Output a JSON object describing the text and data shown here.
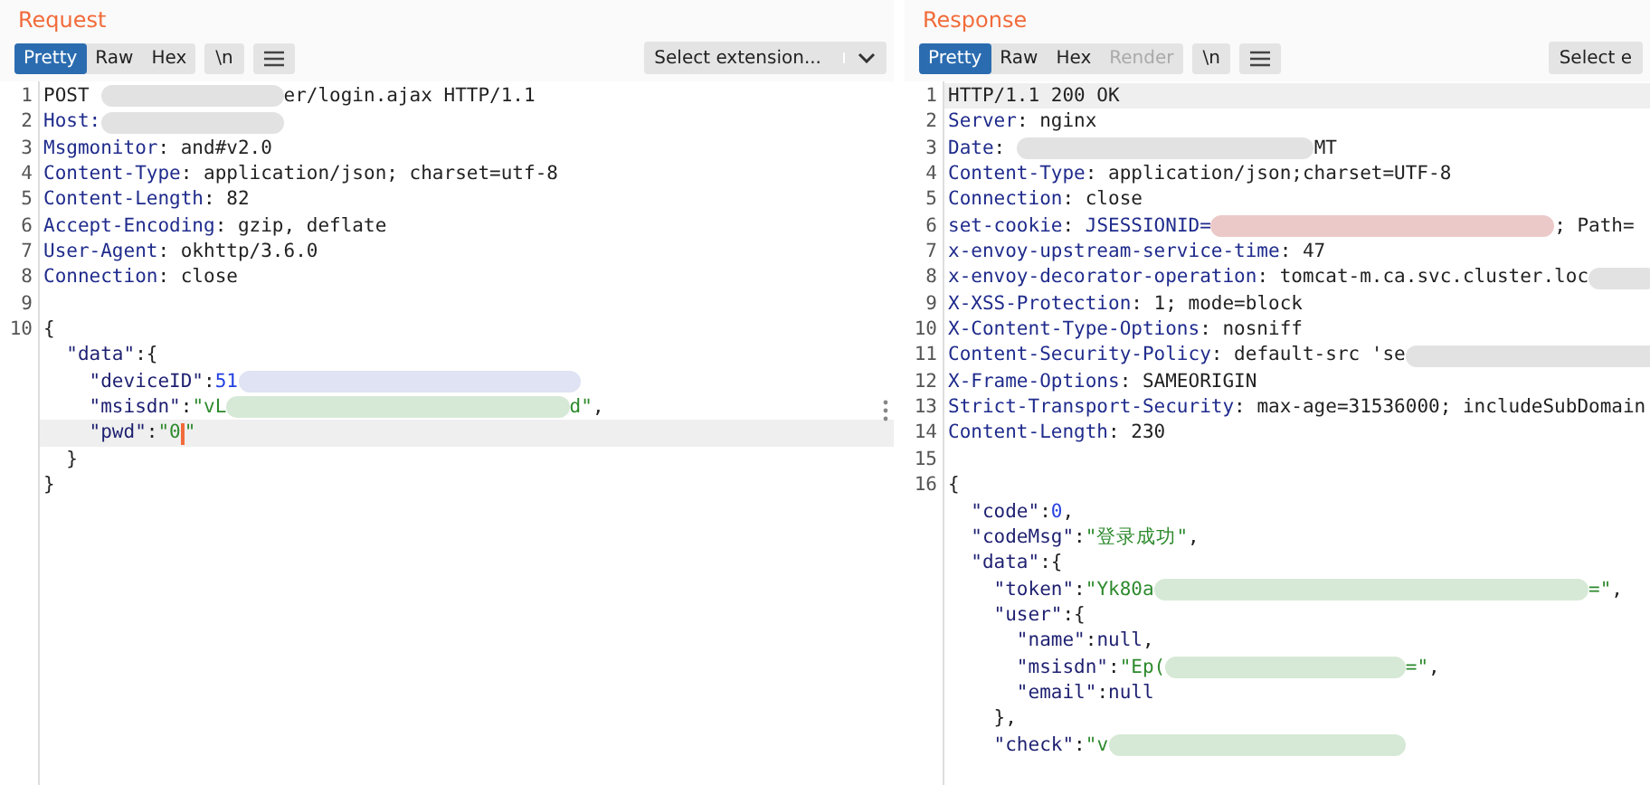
{
  "panels": [
    {
      "title": "Request",
      "view_tabs": [
        {
          "label": "Pretty",
          "selected": true,
          "disabled": false
        },
        {
          "label": "Raw",
          "selected": false,
          "disabled": false
        },
        {
          "label": "Hex",
          "selected": false,
          "disabled": false
        }
      ],
      "newline_button": "\\n",
      "extension_select": "Select extension...",
      "drag_handle": true,
      "lines": [
        {
          "num": "1",
          "current": false,
          "segs": [
            {
              "kind": "plain",
              "t": "POST "
            },
            {
              "kind": "blurmedium",
              "color": "#e2e2e2"
            },
            {
              "kind": "plain",
              "t": "er/login.ajax HTTP/1.1"
            }
          ]
        },
        {
          "num": "2",
          "current": false,
          "segs": [
            {
              "kind": "header",
              "t": "Host:"
            },
            {
              "kind": "blurmedium",
              "color": "#e2e2e2"
            }
          ]
        },
        {
          "num": "3",
          "current": false,
          "segs": [
            {
              "kind": "header",
              "t": "Msgmonitor"
            },
            {
              "kind": "plain",
              "t": ": and#v2.0"
            }
          ]
        },
        {
          "num": "4",
          "current": false,
          "segs": [
            {
              "kind": "header",
              "t": "Content-Type"
            },
            {
              "kind": "plain",
              "t": ": application/json; charset=utf-8"
            }
          ]
        },
        {
          "num": "5",
          "current": false,
          "segs": [
            {
              "kind": "header",
              "t": "Content-Length"
            },
            {
              "kind": "plain",
              "t": ": 82"
            }
          ]
        },
        {
          "num": "6",
          "current": false,
          "segs": [
            {
              "kind": "header",
              "t": "Accept-Encoding"
            },
            {
              "kind": "plain",
              "t": ": gzip, deflate"
            }
          ]
        },
        {
          "num": "7",
          "current": false,
          "segs": [
            {
              "kind": "header",
              "t": "User-Agent"
            },
            {
              "kind": "plain",
              "t": ": okhttp/3.6.0"
            }
          ]
        },
        {
          "num": "8",
          "current": false,
          "segs": [
            {
              "kind": "header",
              "t": "Connection"
            },
            {
              "kind": "plain",
              "t": ": close"
            }
          ]
        },
        {
          "num": "9",
          "current": false
        },
        {
          "num": "10",
          "current": false,
          "segs": [
            {
              "kind": "plain",
              "t": "{"
            }
          ]
        },
        {
          "current": false,
          "segs": [
            {
              "kind": "key",
              "t": "  \"data\""
            },
            {
              "kind": "plain",
              "t": ":{"
            }
          ]
        },
        {
          "current": false,
          "segs": [
            {
              "kind": "key",
              "t": "    \"deviceID\""
            },
            {
              "kind": "plain",
              "t": ":"
            },
            {
              "kind": "number",
              "t": "51"
            },
            {
              "kind": "blurwide",
              "color": "#dfe3f3"
            }
          ]
        },
        {
          "current": false,
          "segs": [
            {
              "kind": "key",
              "t": "    \"msisdn\""
            },
            {
              "kind": "plain",
              "t": ":"
            },
            {
              "kind": "string",
              "t": "\"vL"
            },
            {
              "kind": "blurwide",
              "color": "#d6e9d6"
            },
            {
              "kind": "string",
              "t": "d\""
            },
            {
              "kind": "plain",
              "t": ","
            }
          ]
        },
        {
          "current": true,
          "segs": [
            {
              "kind": "key",
              "t": "    \"pwd\""
            },
            {
              "kind": "plain",
              "t": ":"
            },
            {
              "kind": "string",
              "t": "\"0"
            },
            {
              "kind": "caret"
            },
            {
              "kind": "string",
              "t": "\""
            }
          ]
        },
        {
          "current": false,
          "segs": [
            {
              "kind": "plain",
              "t": "  }"
            }
          ]
        },
        {
          "current": false,
          "segs": [
            {
              "kind": "plain",
              "t": "}"
            }
          ]
        }
      ]
    },
    {
      "title": "Response",
      "view_tabs": [
        {
          "label": "Pretty",
          "selected": true,
          "disabled": false
        },
        {
          "label": "Raw",
          "selected": false,
          "disabled": false
        },
        {
          "label": "Hex",
          "selected": false,
          "disabled": false
        },
        {
          "label": "Render",
          "selected": false,
          "disabled": true
        }
      ],
      "newline_button": "\\n",
      "extension_select": "Select e",
      "drag_handle": false,
      "lines": [
        {
          "num": "1",
          "current": true,
          "segs": [
            {
              "kind": "plain",
              "t": "HTTP/1.1 200 OK"
            }
          ]
        },
        {
          "num": "2",
          "current": false,
          "segs": [
            {
              "kind": "header",
              "t": "Server"
            },
            {
              "kind": "plain",
              "t": ": nginx"
            }
          ]
        },
        {
          "num": "3",
          "current": false,
          "segs": [
            {
              "kind": "header",
              "t": "Date"
            },
            {
              "kind": "plain",
              "t": ": "
            },
            {
              "kind": "blurlonger",
              "color": "#e2e2e2"
            },
            {
              "kind": "plain",
              "t": "MT"
            }
          ]
        },
        {
          "num": "4",
          "current": false,
          "segs": [
            {
              "kind": "header",
              "t": "Content-Type"
            },
            {
              "kind": "plain",
              "t": ": application/json;charset=UTF-8"
            }
          ]
        },
        {
          "num": "5",
          "current": false,
          "segs": [
            {
              "kind": "header",
              "t": "Connection"
            },
            {
              "kind": "plain",
              "t": ": close"
            }
          ]
        },
        {
          "num": "6",
          "current": false,
          "segs": [
            {
              "kind": "header",
              "t": "set-cookie"
            },
            {
              "kind": "plain",
              "t": ": "
            },
            {
              "kind": "header",
              "t": "JSESSIONID="
            },
            {
              "kind": "blurwide",
              "color": "#ecc9c9"
            },
            {
              "kind": "plain",
              "t": "; Path="
            }
          ]
        },
        {
          "num": "7",
          "current": false,
          "segs": [
            {
              "kind": "header",
              "t": "x-envoy-upstream-service-time"
            },
            {
              "kind": "plain",
              "t": ": 47"
            }
          ]
        },
        {
          "num": "8",
          "current": false,
          "segs": [
            {
              "kind": "header",
              "t": "x-envoy-decorator-operation"
            },
            {
              "kind": "plain",
              "t": ": tomcat-m.ca.svc.cluster.loc"
            },
            {
              "kind": "blurshort",
              "color": "#e2e2e2"
            }
          ]
        },
        {
          "num": "9",
          "current": false,
          "segs": [
            {
              "kind": "header",
              "t": "X-XSS-Protection"
            },
            {
              "kind": "plain",
              "t": ": 1; mode=block"
            }
          ]
        },
        {
          "num": "10",
          "current": false,
          "segs": [
            {
              "kind": "header",
              "t": "X-Content-Type-Options"
            },
            {
              "kind": "plain",
              "t": ": nosniff"
            }
          ]
        },
        {
          "num": "11",
          "current": false,
          "segs": [
            {
              "kind": "header",
              "t": "Content-Security-Policy"
            },
            {
              "kind": "plain",
              "t": ": default-src 'se"
            },
            {
              "kind": "blurlonger",
              "color": "#e2e2e2"
            }
          ]
        },
        {
          "num": "12",
          "current": false,
          "segs": [
            {
              "kind": "header",
              "t": "X-Frame-Options"
            },
            {
              "kind": "plain",
              "t": ": SAMEORIGIN"
            }
          ]
        },
        {
          "num": "13",
          "current": false,
          "segs": [
            {
              "kind": "header",
              "t": "Strict-Transport-Security"
            },
            {
              "kind": "plain",
              "t": ": max-age=31536000; includeSubDomain"
            }
          ]
        },
        {
          "num": "14",
          "current": false,
          "segs": [
            {
              "kind": "header",
              "t": "Content-Length"
            },
            {
              "kind": "plain",
              "t": ": 230"
            }
          ]
        },
        {
          "num": "15",
          "current": false
        },
        {
          "num": "16",
          "current": false,
          "segs": [
            {
              "kind": "plain",
              "t": "{"
            }
          ]
        },
        {
          "current": false,
          "segs": [
            {
              "kind": "key",
              "t": "  \"code\""
            },
            {
              "kind": "plain",
              "t": ":"
            },
            {
              "kind": "number",
              "t": "0"
            },
            {
              "kind": "plain",
              "t": ","
            }
          ]
        },
        {
          "current": false,
          "segs": [
            {
              "kind": "key",
              "t": "  \"codeMsg\""
            },
            {
              "kind": "plain",
              "t": ":"
            },
            {
              "kind": "string",
              "t": "\"登录成功\""
            },
            {
              "kind": "plain",
              "t": ","
            }
          ]
        },
        {
          "current": false,
          "segs": [
            {
              "kind": "key",
              "t": "  \"data\""
            },
            {
              "kind": "plain",
              "t": ":{"
            }
          ]
        },
        {
          "current": false,
          "segs": [
            {
              "kind": "key",
              "t": "    \"token\""
            },
            {
              "kind": "plain",
              "t": ":"
            },
            {
              "kind": "string",
              "t": "\"Yk80a"
            },
            {
              "kind": "blurwidest",
              "color": "#d6e9d6"
            },
            {
              "kind": "string",
              "t": "=\""
            },
            {
              "kind": "plain",
              "t": ","
            }
          ]
        },
        {
          "current": false,
          "segs": [
            {
              "kind": "key",
              "t": "    \"user\""
            },
            {
              "kind": "plain",
              "t": ":{"
            }
          ]
        },
        {
          "current": false,
          "segs": [
            {
              "kind": "key",
              "t": "      \"name\""
            },
            {
              "kind": "plain",
              "t": ":"
            },
            {
              "kind": "key",
              "t": "null"
            },
            {
              "kind": "plain",
              "t": ","
            }
          ]
        },
        {
          "current": false,
          "segs": [
            {
              "kind": "key",
              "t": "      \"msisdn\""
            },
            {
              "kind": "plain",
              "t": ":"
            },
            {
              "kind": "string",
              "t": "\"Ep("
            },
            {
              "kind": "blurlong",
              "color": "#d6e9d6"
            },
            {
              "kind": "string",
              "t": "=\""
            },
            {
              "kind": "plain",
              "t": ","
            }
          ]
        },
        {
          "current": false,
          "segs": [
            {
              "kind": "key",
              "t": "      \"email\""
            },
            {
              "kind": "plain",
              "t": ":"
            },
            {
              "kind": "key",
              "t": "null"
            }
          ]
        },
        {
          "current": false,
          "segs": [
            {
              "kind": "plain",
              "t": "    },"
            }
          ]
        },
        {
          "current": false,
          "segs": [
            {
              "kind": "key",
              "t": "    \"check\""
            },
            {
              "kind": "plain",
              "t": ":"
            },
            {
              "kind": "string",
              "t": "\"v"
            },
            {
              "kind": "blurlonger",
              "color": "#d6e9d6"
            }
          ]
        }
      ]
    }
  ]
}
